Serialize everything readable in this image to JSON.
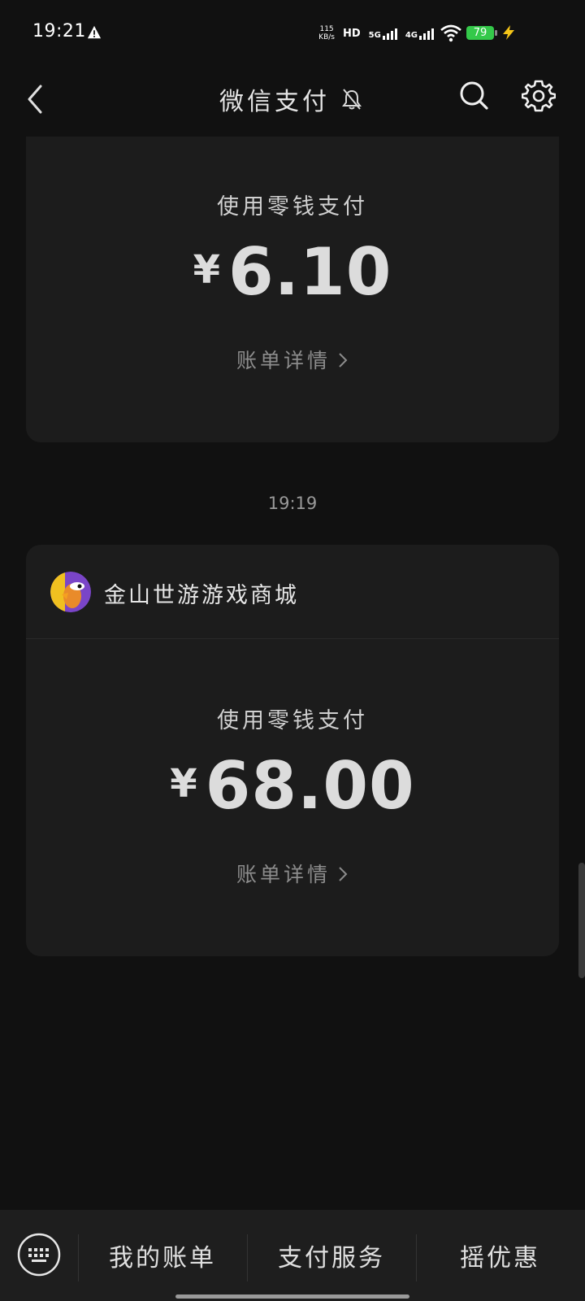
{
  "status": {
    "time": "19:21",
    "net_speed_value": "115",
    "net_speed_unit": "KB/s",
    "hd": "HD",
    "sim1": "5G",
    "sim2": "4G",
    "battery": "79"
  },
  "header": {
    "title": "微信支付"
  },
  "payments": [
    {
      "pay_label": "使用零钱支付",
      "currency": "¥",
      "amount": "6.10",
      "detail_link": "账单详情"
    },
    {
      "merchant": "金山世游游戏商城",
      "pay_label": "使用零钱支付",
      "currency": "¥",
      "amount": "68.00",
      "detail_link": "账单详情"
    }
  ],
  "timestamp": "19:19",
  "bottom_menu": {
    "items": [
      "我的账单",
      "支付服务",
      "摇优惠"
    ]
  },
  "colors": {
    "background": "#111111",
    "card": "#1c1c1c",
    "battery": "#34c94a",
    "charge": "#f5c518"
  }
}
